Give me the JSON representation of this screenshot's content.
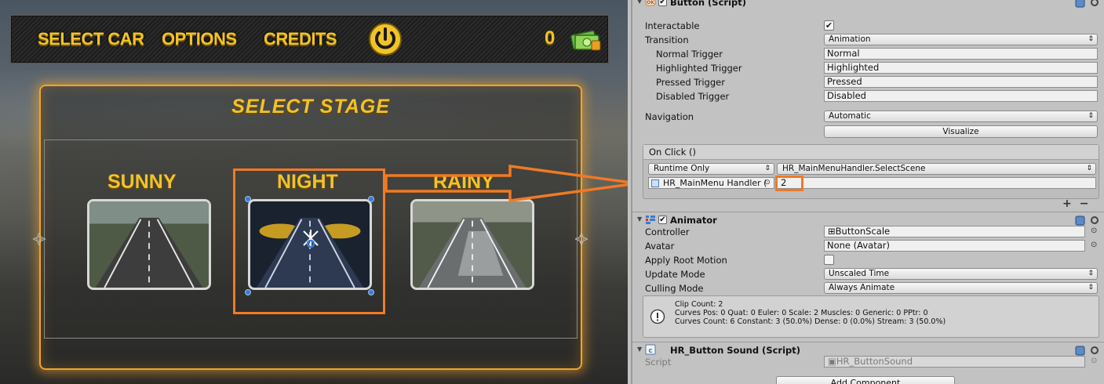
{
  "game": {
    "menu": {
      "select_car": "SELECT CAR",
      "options": "OPTIONS",
      "credits": "CREDITS"
    },
    "coin_count": "0",
    "stage_title": "SELECT STAGE",
    "stages": [
      {
        "label": "SUNNY"
      },
      {
        "label": "NIGHT"
      },
      {
        "label": "RAINY"
      }
    ],
    "icons": [
      "power-icon",
      "money-icon",
      "anchor-icon",
      "pivot-icon"
    ],
    "highlight_color": "#f07a24",
    "accent_color": "#f2c22a"
  },
  "inspector": {
    "button_component": {
      "title": "Button (Script)",
      "interactable_label": "Interactable",
      "interactable_checked": "✔",
      "transition_label": "Transition",
      "transition_value": "Animation",
      "normal_trigger_label": "Normal Trigger",
      "normal_trigger_value": "Normal",
      "highlighted_trigger_label": "Highlighted Trigger",
      "highlighted_trigger_value": "Highlighted",
      "pressed_trigger_label": "Pressed Trigger",
      "pressed_trigger_value": "Pressed",
      "disabled_trigger_label": "Disabled Trigger",
      "disabled_trigger_value": "Disabled",
      "navigation_label": "Navigation",
      "navigation_value": "Automatic",
      "visualize_label": "Visualize"
    },
    "on_click": {
      "header": "On Click ()",
      "runtime": "Runtime Only",
      "function": "HR_MainMenuHandler.SelectScene",
      "object": "HR_MainMenu Handler (",
      "argument": "2",
      "plus": "+",
      "minus": "−"
    },
    "animator": {
      "title": "Animator",
      "controller_label": "Controller",
      "controller_value": "ButtonScale",
      "avatar_label": "Avatar",
      "avatar_value": "None (Avatar)",
      "apply_root_motion_label": "Apply Root Motion",
      "update_mode_label": "Update Mode",
      "update_mode_value": "Unscaled Time",
      "culling_mode_label": "Culling Mode",
      "culling_mode_value": "Always Animate",
      "info_lines": [
        "Clip Count: 2",
        "Curves Pos: 0 Quat: 0 Euler: 0 Scale: 2 Muscles: 0 Generic: 0 PPtr: 0",
        "Curves Count: 6 Constant: 3 (50.0%) Dense: 0 (0.0%) Stream: 3 (50.0%)"
      ]
    },
    "button_sound": {
      "title": "HR_Button Sound (Script)",
      "script_label": "Script",
      "script_value": "HR_ButtonSound"
    },
    "add_component": "Add Component"
  }
}
